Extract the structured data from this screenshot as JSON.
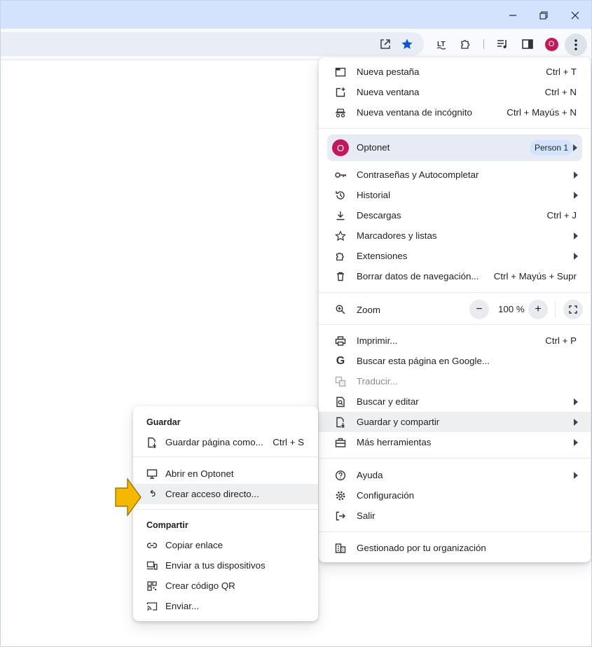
{
  "colors": {
    "accent": "#0b57d0",
    "avatar": "#c2185b",
    "callout_arrow": "#f5b800",
    "titlebar": "#d3e3fd"
  },
  "toolbar": {
    "avatar_letter": "O"
  },
  "menu": {
    "items_top": [
      {
        "label": "Nueva pestaña",
        "shortcut": "Ctrl + T",
        "icon": "new-tab-icon"
      },
      {
        "label": "Nueva ventana",
        "shortcut": "Ctrl + N",
        "icon": "new-window-icon"
      },
      {
        "label": "Nueva ventana de incógnito",
        "shortcut": "Ctrl + Mayús + N",
        "icon": "incognito-icon"
      }
    ],
    "profile": {
      "name": "Optonet",
      "letter": "O",
      "badge": "Person 1"
    },
    "items_mid": [
      {
        "label": "Contraseñas y Autocompletar",
        "shortcut": "",
        "icon": "key-icon"
      },
      {
        "label": "Historial",
        "shortcut": "",
        "icon": "history-icon"
      },
      {
        "label": "Descargas",
        "shortcut": "Ctrl + J",
        "icon": "download-icon"
      },
      {
        "label": "Marcadores y listas",
        "shortcut": "",
        "icon": "star-icon"
      },
      {
        "label": "Extensiones",
        "shortcut": "",
        "icon": "puzzle-icon"
      },
      {
        "label": "Borrar datos de navegación...",
        "shortcut": "Ctrl + Mayús + Supr",
        "icon": "trash-icon"
      }
    ],
    "zoom": {
      "label": "Zoom",
      "value": "100 %",
      "minus": "−",
      "plus": "+"
    },
    "items_tools": [
      {
        "label": "Imprimir...",
        "shortcut": "Ctrl + P",
        "icon": "print-icon"
      },
      {
        "label": "Buscar esta página en Google...",
        "shortcut": "",
        "icon": "google-icon"
      },
      {
        "label": "Traducir...",
        "shortcut": "",
        "icon": "translate-icon"
      },
      {
        "label": "Buscar y editar",
        "shortcut": "",
        "icon": "find-edit-icon"
      },
      {
        "label": "Guardar y compartir",
        "shortcut": "",
        "icon": "save-share-icon"
      },
      {
        "label": "Más herramientas",
        "shortcut": "",
        "icon": "toolbox-icon"
      }
    ],
    "items_bottom": [
      {
        "label": "Ayuda",
        "icon": "help-icon"
      },
      {
        "label": "Configuración",
        "icon": "settings-icon"
      },
      {
        "label": "Salir",
        "icon": "exit-icon"
      }
    ],
    "managed": {
      "label": "Gestionado por tu organización"
    }
  },
  "submenu": {
    "save_header": "Guardar",
    "save_page": {
      "label": "Guardar página como...",
      "shortcut": "Ctrl + S"
    },
    "open_in": {
      "label": "Abrir en Optonet"
    },
    "shortcut": {
      "label": "Crear acceso directo..."
    },
    "share_header": "Compartir",
    "share_items": [
      {
        "label": "Copiar enlace"
      },
      {
        "label": "Enviar a tus dispositivos"
      },
      {
        "label": "Crear código QR"
      },
      {
        "label": "Enviar..."
      }
    ]
  }
}
